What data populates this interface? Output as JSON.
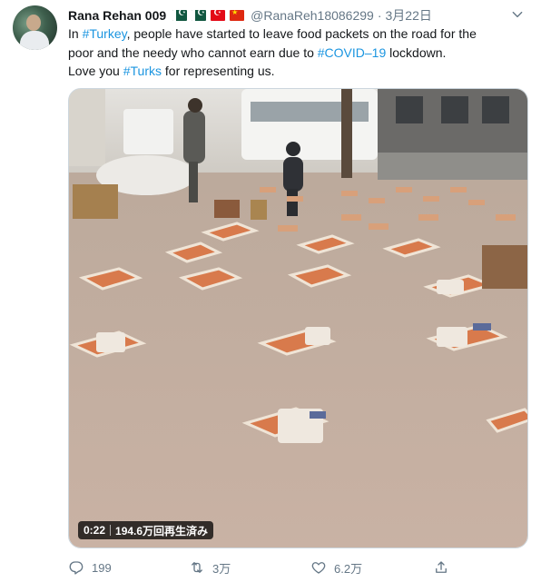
{
  "tweet": {
    "author_name": "Rana Rehan 009",
    "author_handle": "@RanaReh18086299",
    "separator": "·",
    "date": "3月22日",
    "flags": [
      "pakistan-flag",
      "pakistan-flag",
      "turkey-flag",
      "china-flag"
    ],
    "text": {
      "line1_pre": "In ",
      "tag_turkey": "#Turkey",
      "line1_post": ", people have started to leave food packets on the road for the",
      "line2_pre": "poor and the needy who cannot earn due to ",
      "tag_covid": "#COVID–19",
      "line2_post": " lockdown.",
      "line3_pre": "Love you ",
      "tag_turks": "#Turks",
      "line3_post": " for representing us."
    },
    "hashtag_color": "#1b95e0",
    "media": {
      "duration": "0:22",
      "views": "194.6万回再生済み"
    },
    "actions": {
      "replies": "199",
      "retweets": "3万",
      "likes": "6.2万"
    }
  }
}
